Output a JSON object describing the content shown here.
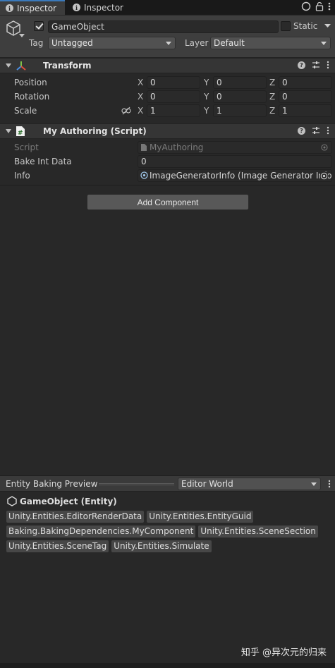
{
  "tabs": [
    {
      "label": "Inspector",
      "active": true
    },
    {
      "label": "Inspector",
      "active": false
    }
  ],
  "gameobject": {
    "active": true,
    "name": "GameObject",
    "static_label": "Static",
    "static": false,
    "tag_label": "Tag",
    "tag_value": "Untagged",
    "layer_label": "Layer",
    "layer_value": "Default"
  },
  "transform": {
    "title": "Transform",
    "rows": [
      {
        "label": "Position",
        "x": "0",
        "y": "0",
        "z": "0"
      },
      {
        "label": "Rotation",
        "x": "0",
        "y": "0",
        "z": "0"
      },
      {
        "label": "Scale",
        "x": "1",
        "y": "1",
        "z": "1"
      }
    ],
    "axes": [
      "X",
      "Y",
      "Z"
    ]
  },
  "authoring": {
    "title": "My Authoring (Script)",
    "script_label": "Script",
    "script_value": "MyAuthoring",
    "bake_label": "Bake Int Data",
    "bake_value": "0",
    "info_label": "Info",
    "info_value": "ImageGeneratorInfo (Image Generator Info)"
  },
  "add_component": "Add Component",
  "preview": {
    "title": "Entity Baking Preview",
    "world": "Editor World",
    "entity": "GameObject (Entity)",
    "components": [
      "Unity.Entities.EditorRenderData",
      "Unity.Entities.EntityGuid",
      "Baking.BakingDependencies.MyComponent",
      "Unity.Entities.SceneSection",
      "Unity.Entities.SceneTag",
      "Unity.Entities.Simulate"
    ]
  },
  "watermark": "知乎 @异次元的归来",
  "colors": {
    "tab_accent": "#3a79bb",
    "background": "#282828",
    "header": "#3e3e3e"
  }
}
